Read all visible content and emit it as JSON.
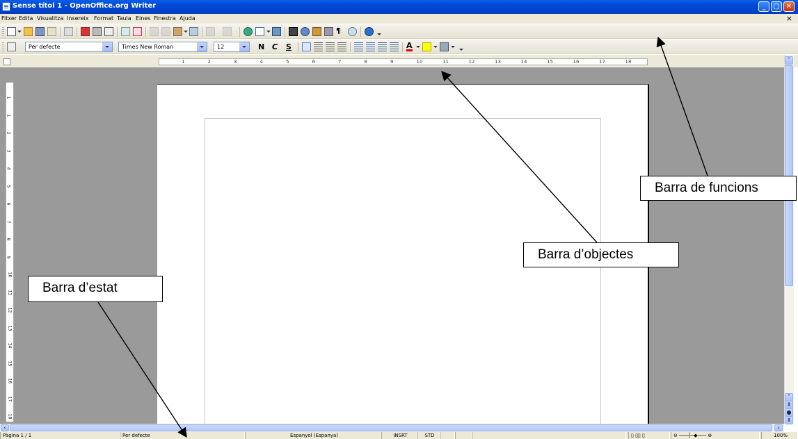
{
  "window": {
    "title": "Sense títol 1 - OpenOffice.org Writer",
    "controls": [
      "minimize",
      "maximize",
      "close"
    ]
  },
  "menu": {
    "items": [
      "Fitxer",
      "Edita",
      "Visualitza",
      "Insereix",
      "Format",
      "Taula",
      "Eines",
      "Finestra",
      "Ajuda"
    ]
  },
  "formatting": {
    "style": "Per defecte",
    "font": "Times New Roman",
    "size": "12",
    "bold_label": "N",
    "italic_label": "C",
    "underline_label": "S"
  },
  "ruler": {
    "h_numbers": [
      "1",
      "2",
      "3",
      "4",
      "5",
      "6",
      "7",
      "8",
      "9",
      "10",
      "11",
      "12",
      "13",
      "14",
      "15",
      "16",
      "17",
      "18"
    ],
    "v_numbers": [
      "1",
      "1",
      "2",
      "3",
      "4",
      "5",
      "6",
      "7",
      "8",
      "9",
      "10",
      "11",
      "12",
      "13",
      "14",
      "15",
      "16",
      "17",
      "18"
    ]
  },
  "status": {
    "page": "Pàgina  1 / 1",
    "style": "Per defecte",
    "language": "Espanyol (Espanya)",
    "insert_mode": "INSRT",
    "selection_mode": "STD",
    "zoom": "100%"
  },
  "annotations": {
    "function_bar": "Barra de funcions",
    "object_bar": "Barra d’objectes",
    "status_bar": "Barra d’estat"
  },
  "colors": {
    "titlebar": "#0047d5",
    "workspace": "#9a9a9a",
    "chrome": "#ece9d8"
  }
}
